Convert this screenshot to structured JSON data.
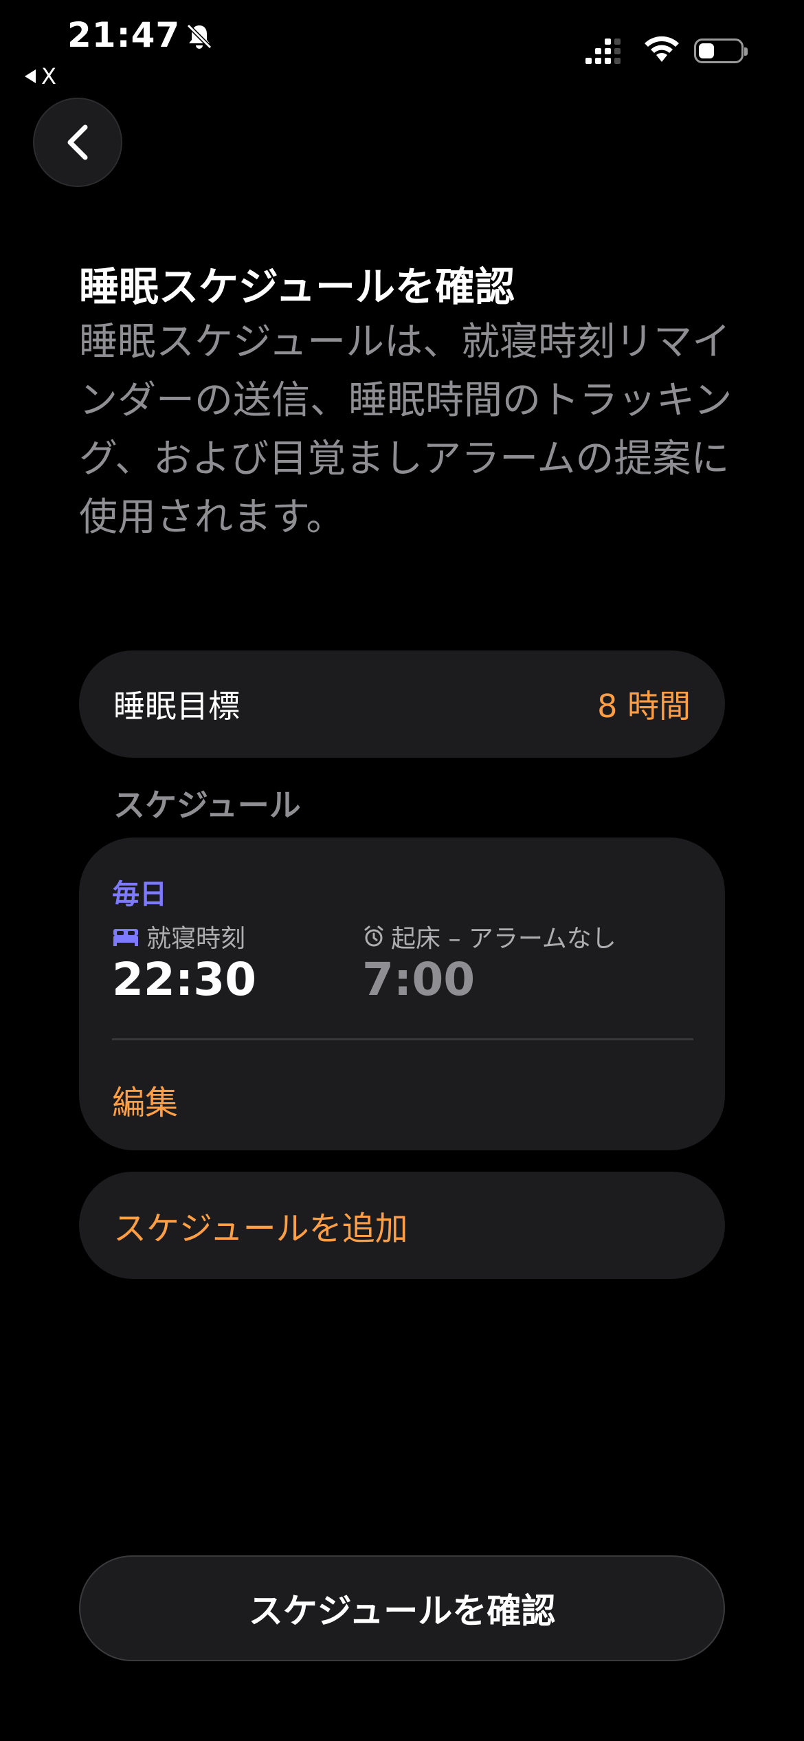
{
  "status_bar": {
    "time": "21:47",
    "back_app_label": "X"
  },
  "header": {
    "title": "睡眠スケジュールを確認",
    "description": "睡眠スケジュールは、就寝時刻リマインダーの送信、睡眠時間のトラッキング、および目覚ましアラームの提案に使用されます。"
  },
  "sleep_goal": {
    "label": "睡眠目標",
    "value": "8 時間"
  },
  "schedule_section": {
    "label": "スケジュール",
    "frequency": "毎日",
    "bedtime_label": "就寝時刻",
    "bedtime_value": "22:30",
    "wake_label": "起床 – アラームなし",
    "wake_value": "7:00",
    "edit_label": "編集"
  },
  "add_schedule": {
    "label": "スケジュールを追加"
  },
  "confirm_button": {
    "label": "スケジュールを確認"
  },
  "colors": {
    "accent_orange": "#ff9f45",
    "accent_purple": "#7d7aff",
    "card_bg": "#1c1c1e",
    "secondary_text": "#8e8e93"
  },
  "icons": [
    "bell-slash-icon",
    "signal-icon",
    "wifi-icon",
    "battery-icon",
    "chevron-left-icon",
    "bed-icon",
    "alarm-clock-icon"
  ]
}
